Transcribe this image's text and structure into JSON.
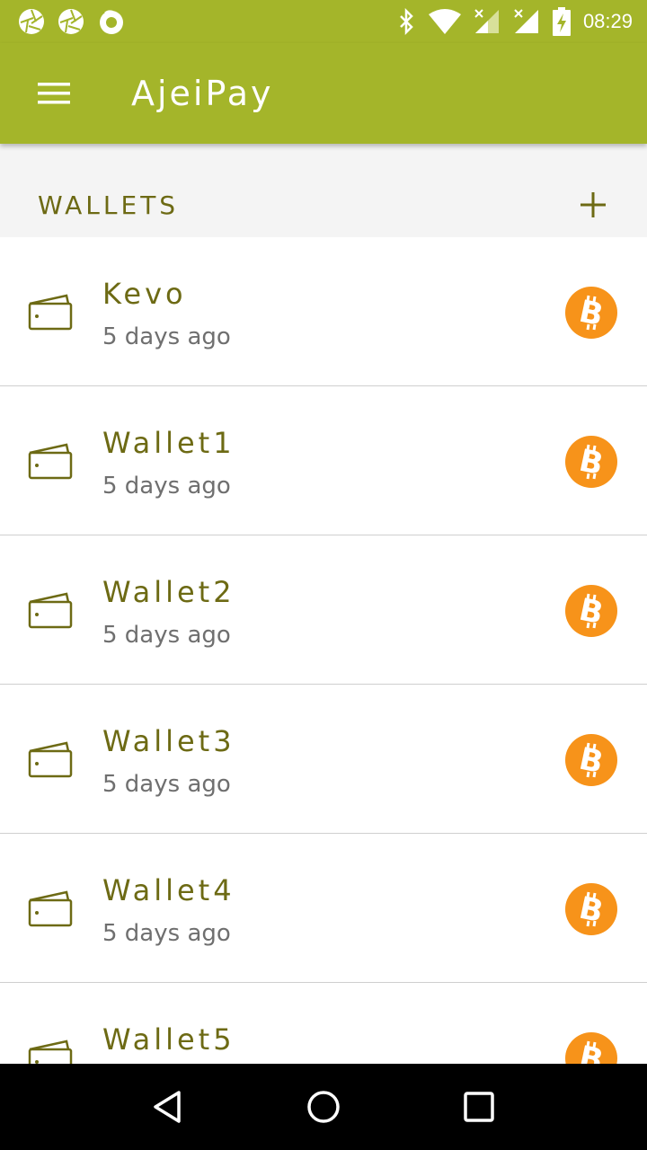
{
  "status_bar": {
    "time": "08:29",
    "left_icons": [
      "aperture-icon",
      "aperture-icon",
      "firefox-icon"
    ],
    "right_icons": [
      "bluetooth-icon",
      "wifi-icon",
      "signal-icon",
      "signal-icon",
      "battery-charging-icon"
    ]
  },
  "app_bar": {
    "title": "AjeiPay",
    "background": "#a4b52a"
  },
  "section": {
    "title": "WALLETS"
  },
  "wallets": [
    {
      "name": "Kevo",
      "time": "5 days ago"
    },
    {
      "name": "Wallet1",
      "time": "5 days ago"
    },
    {
      "name": "Wallet2",
      "time": "5 days ago"
    },
    {
      "name": "Wallet3",
      "time": "5 days ago"
    },
    {
      "name": "Wallet4",
      "time": "5 days ago"
    },
    {
      "name": "Wallet5",
      "time": ""
    }
  ],
  "colors": {
    "accent": "#a4b52a",
    "text_olive": "#6d6a14",
    "bitcoin": "#f7931a"
  }
}
